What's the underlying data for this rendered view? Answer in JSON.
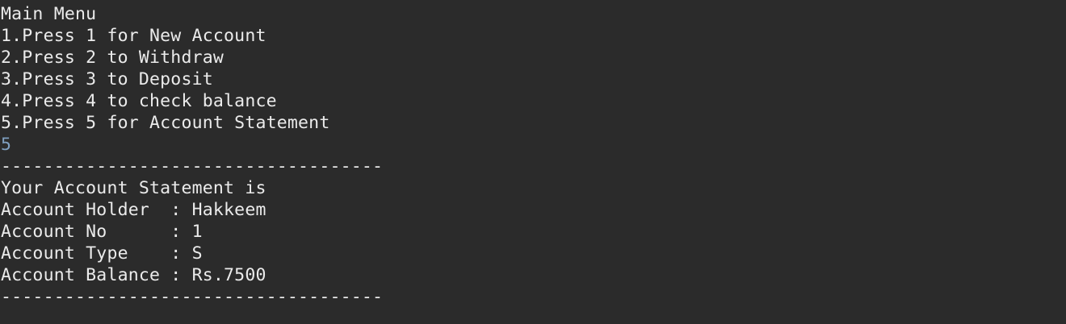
{
  "menu": {
    "title": "Main Menu",
    "options": [
      "1.Press 1 for New Account",
      "2.Press 2 to Withdraw",
      "3.Press 3 to Deposit",
      "4.Press 4 to check balance",
      "5.Press 5 for Account Statement"
    ]
  },
  "input": {
    "value": "5",
    "color": "#7f9fbf"
  },
  "separator": "------------------------------------",
  "statement": {
    "heading": "Your Account Statement is",
    "lines": [
      "Account Holder  : Hakkeem",
      "Account No      : 1",
      "Account Type    : S",
      "Account Balance : Rs.7500"
    ]
  },
  "colors": {
    "background": "#2b2b2b",
    "text": "#ebebeb"
  }
}
